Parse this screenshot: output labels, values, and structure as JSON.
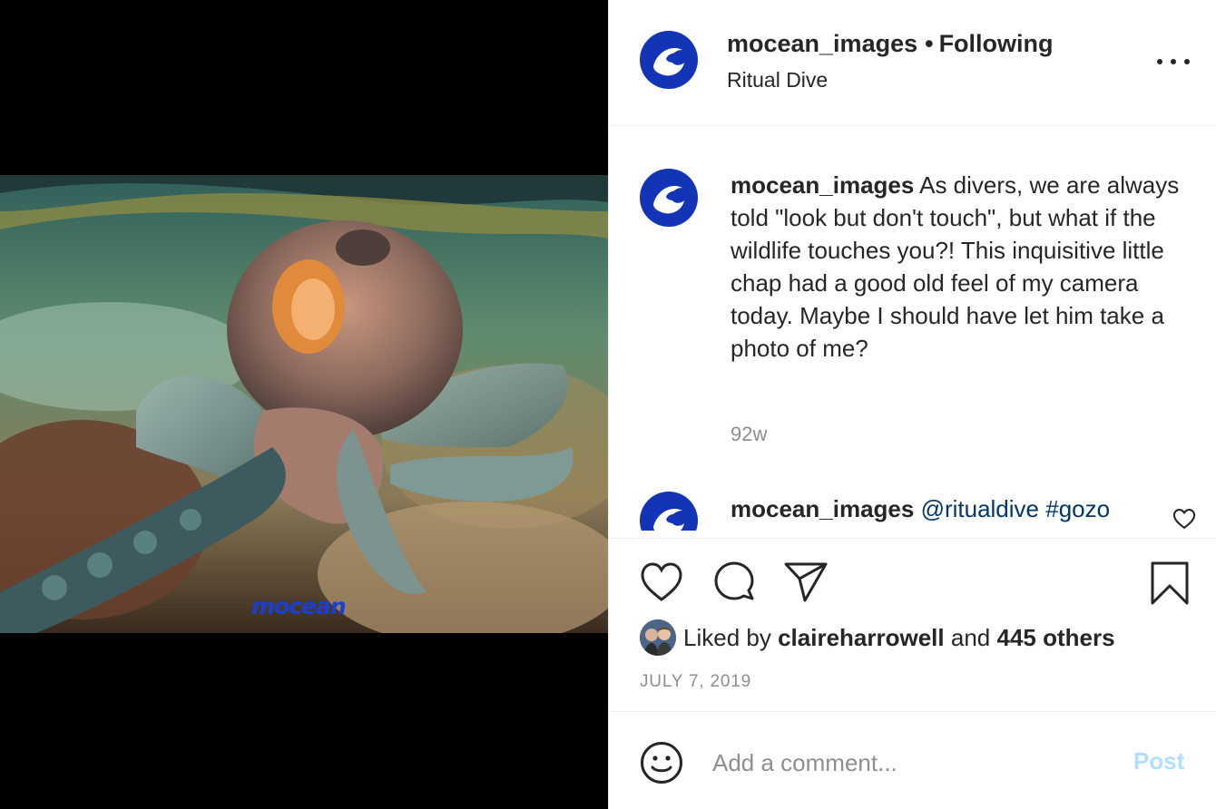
{
  "post": {
    "watermark": "mocean"
  },
  "header": {
    "username": "mocean_images",
    "separator": "•",
    "follow_status": "Following",
    "location": "Ritual Dive",
    "more_icon": "more-options-icon"
  },
  "caption": {
    "username": "mocean_images",
    "text": " As divers, we are always told \"look but don't touch\", but what if the wildlife touches you?! This inquisitive little chap had a good old feel of my camera today. Maybe I should have let him take a photo of me?",
    "time": "92w"
  },
  "comment": {
    "username": "mocean_images",
    "mention": "@ritualdive",
    "hashtag": "#gozo"
  },
  "actions": {
    "like_icon": "heart-icon",
    "comment_icon": "comment-icon",
    "share_icon": "share-icon",
    "save_icon": "bookmark-icon"
  },
  "likes": {
    "prefix": "Liked by",
    "user": "claireharrowell",
    "connector": "and",
    "others": "445 others"
  },
  "date": "JULY 7, 2019",
  "comment_box": {
    "placeholder": "Add a comment...",
    "post_label": "Post"
  },
  "colors": {
    "brand_blue": "#1434b8",
    "link": "#00376b",
    "muted": "#8e8e8e",
    "post_disabled": "#b2dffc"
  }
}
